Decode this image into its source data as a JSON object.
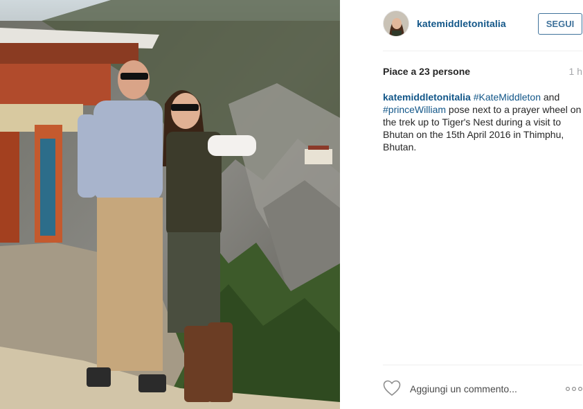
{
  "post": {
    "username": "katemiddletonitalia",
    "follow_label": "SEGUI",
    "likes_text": "Piace a 23 persone",
    "time_ago": "1 h",
    "caption": {
      "user": "katemiddletonitalia",
      "tag1": "#KateMiddleton",
      "word_and": " and ",
      "tag2": "#princeWilliam",
      "text": " pose next to a prayer wheel on the trek up to Tiger's Nest during a visit to Bhutan on the 15th April 2016 in Thimphu, Bhutan."
    },
    "comment_placeholder": "Aggiungi un commento...",
    "icons": {
      "like": "heart-outline-icon",
      "more": "more-options-icon"
    }
  },
  "colors": {
    "link": "#125688",
    "follow": "#3f729b",
    "muted": "#a5a7aa",
    "divider": "#efefef"
  }
}
